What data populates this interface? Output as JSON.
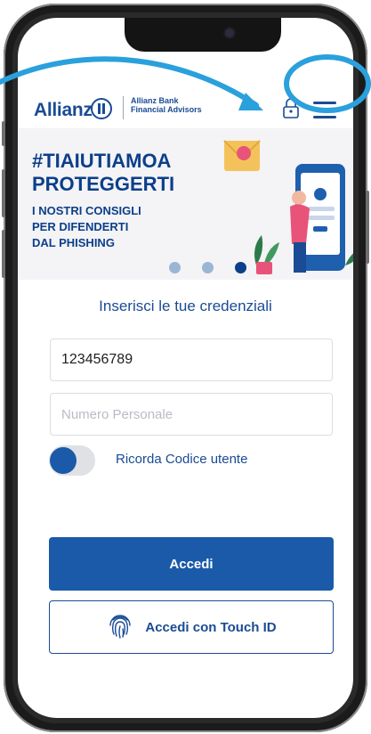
{
  "app": {
    "brand": "Allianz",
    "brand_sub_line1": "Allianz Bank",
    "brand_sub_line2": "Financial Advisors",
    "accent": "#1a4b94"
  },
  "banner": {
    "hashtag_line1": "#TIAIUTIAMOA",
    "hashtag_line2": "PROTEGGERTI",
    "tips_line1": "I NOSTRI CONSIGLI",
    "tips_line2": "PER DIFENDERTI",
    "tips_line3": "DAL PHISHING",
    "slide_count": 3,
    "active_slide": 3
  },
  "login": {
    "title": "Inserisci le tue credenziali",
    "user_code_value": "123456789",
    "personal_number_placeholder": "Numero Personale",
    "remember_label": "Ricorda Codice utente",
    "remember_on": true,
    "login_button": "Accedi",
    "touch_id_button": "Accedi con Touch ID"
  },
  "icons": {
    "menu": "hamburger-menu-icon",
    "lock": "lock-icon",
    "touch": "fingerprint-icon"
  }
}
